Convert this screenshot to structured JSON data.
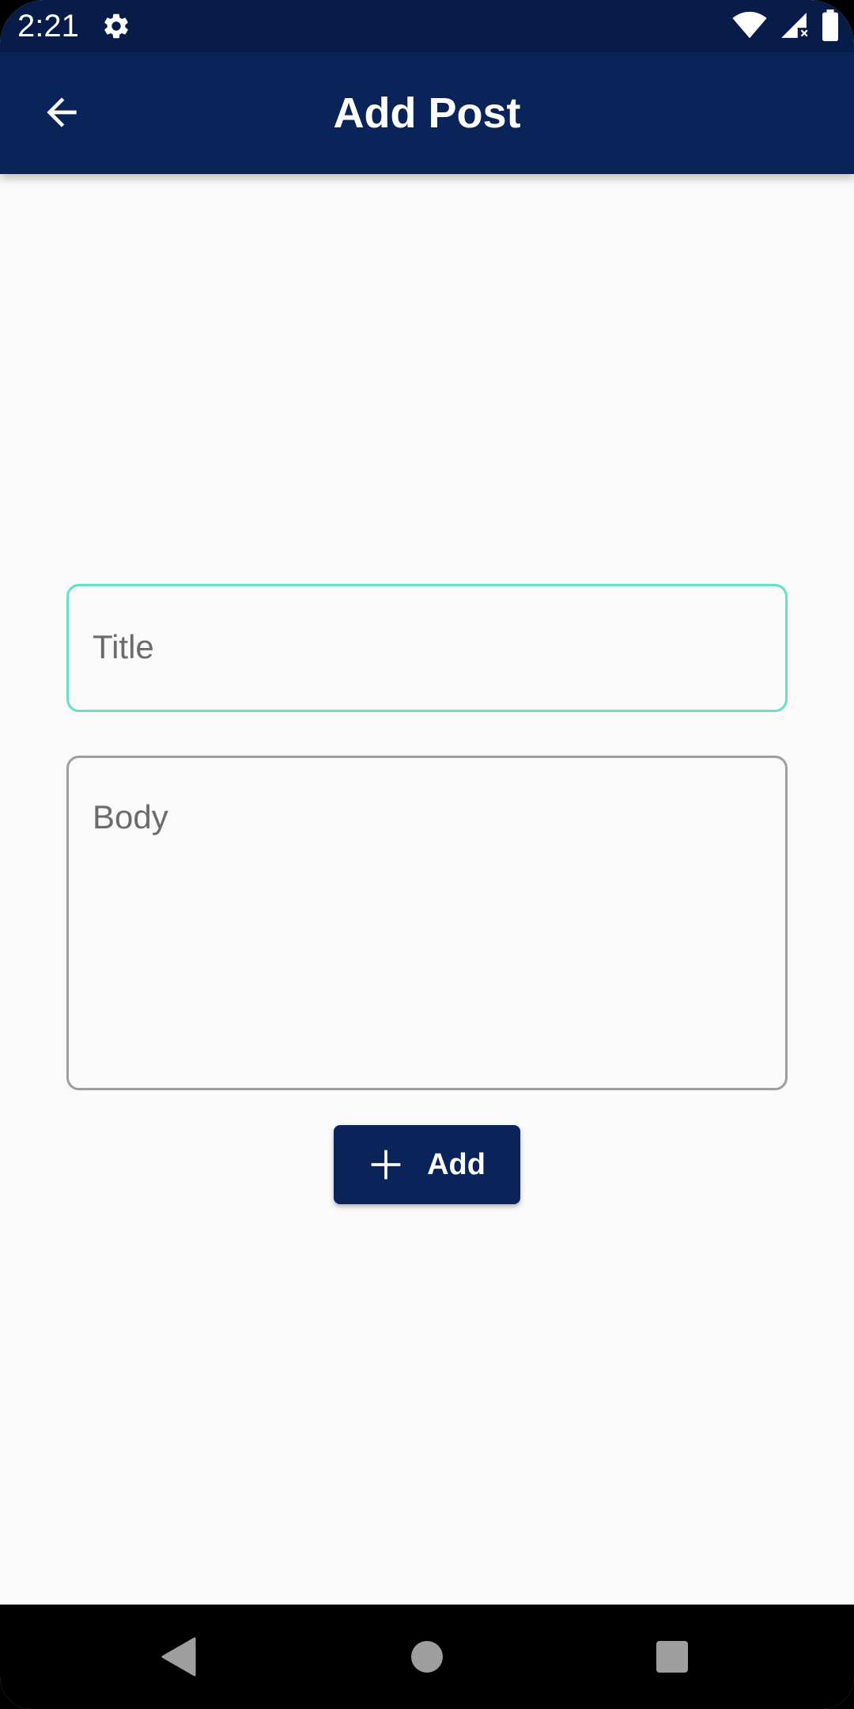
{
  "status_bar": {
    "time": "2:21",
    "icons": [
      "gear-icon",
      "wifi-icon",
      "signal-icon",
      "battery-icon"
    ]
  },
  "app_bar": {
    "title": "Add Post",
    "back_icon": "arrow-back-icon",
    "background_color": "#0a2359"
  },
  "form": {
    "title_field": {
      "placeholder": "Title",
      "value": "",
      "focused": true,
      "border_color": "#64e0c2"
    },
    "body_field": {
      "placeholder": "Body",
      "value": "",
      "border_color": "#9e9e9e"
    },
    "add_button": {
      "label": "Add",
      "icon": "plus-icon"
    }
  },
  "nav_bar": {
    "buttons": [
      "back-triangle-icon",
      "home-circle-icon",
      "recents-square-icon"
    ]
  }
}
